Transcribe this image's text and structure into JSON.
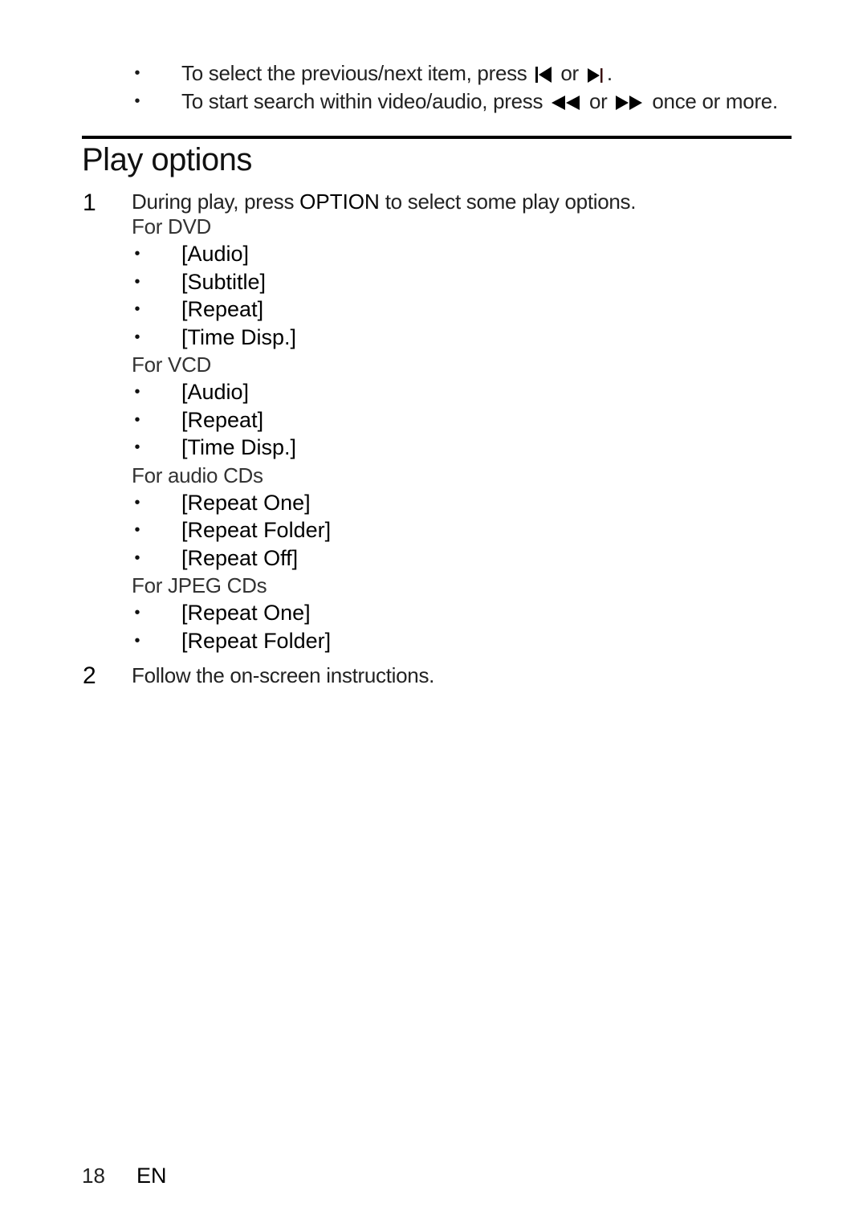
{
  "top_bullets": [
    {
      "prefix": "To select the previous/next item, press ",
      "icon_a": "previous-icon",
      "mid": " or ",
      "icon_b": "next-icon",
      "suffix": "."
    },
    {
      "prefix": "To start search within video/audio, press ",
      "icon_a": "rewind-icon",
      "mid": " or ",
      "icon_b": "fast-forward-icon",
      "suffix": " once or more."
    }
  ],
  "section": {
    "title": "Play options"
  },
  "steps": [
    {
      "number": "1",
      "text_before": "During play, press ",
      "keyword": "OPTION",
      "text_after": " to select some play options.",
      "groups": [
        {
          "label": "For DVD",
          "items": [
            "[Audio]",
            "[Subtitle]",
            "[Repeat]",
            "[Time Disp.]"
          ]
        },
        {
          "label": "For VCD",
          "items": [
            "[Audio]",
            "[Repeat]",
            "[Time Disp.]"
          ]
        },
        {
          "label": "For audio CDs",
          "items": [
            "[Repeat One]",
            "[Repeat Folder]",
            "[Repeat Off]"
          ]
        },
        {
          "label": "For JPEG CDs",
          "items": [
            "[Repeat One]",
            "[Repeat Folder]"
          ]
        }
      ]
    },
    {
      "number": "2",
      "text": "Follow the on-screen instructions."
    }
  ],
  "bullet_glyph": "•",
  "footer": {
    "page_number": "18",
    "language": "EN"
  }
}
